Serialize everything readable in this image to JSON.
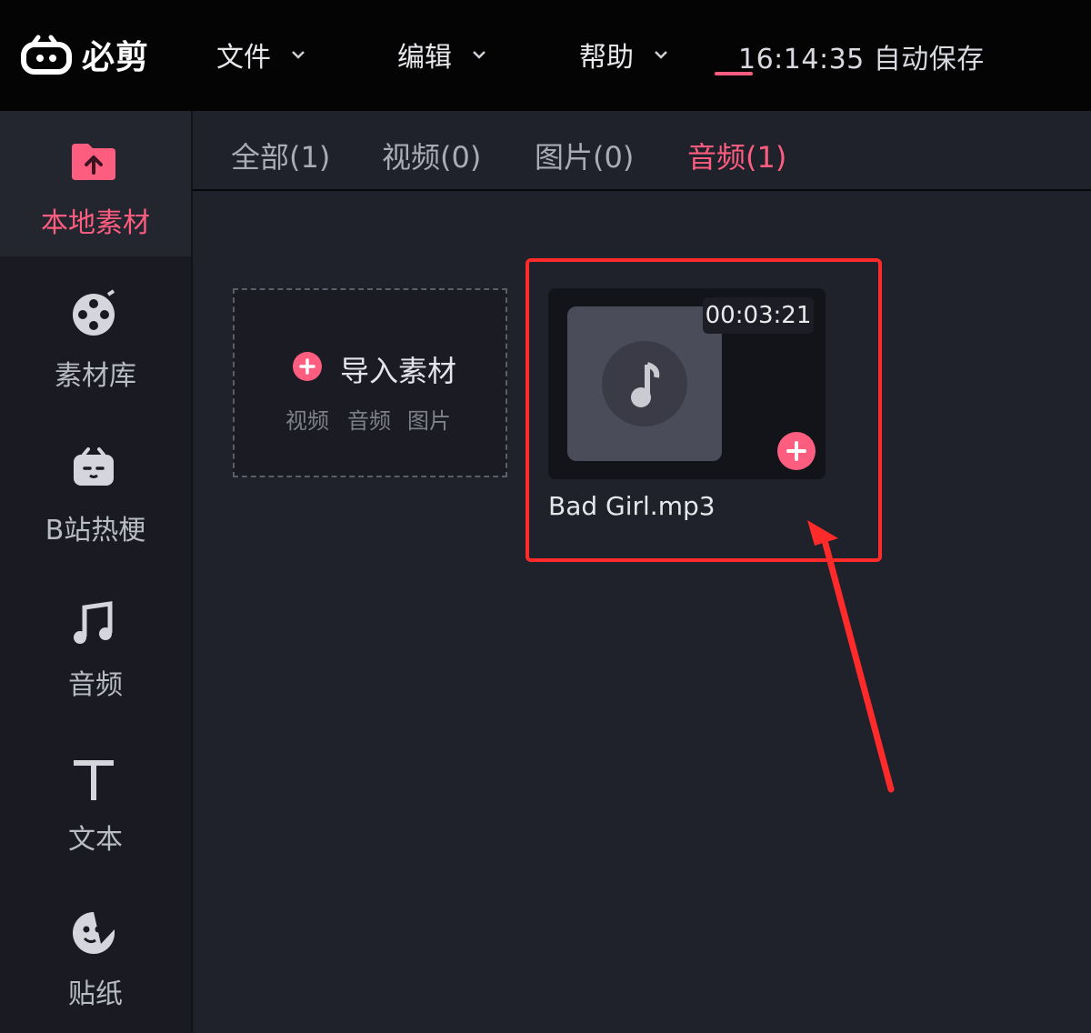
{
  "app": {
    "name": "必剪"
  },
  "menu": {
    "file": "文件",
    "edit": "编辑",
    "help": "帮助"
  },
  "autosave": "16:14:35 自动保存",
  "sidebar": {
    "items": [
      {
        "label": "本地素材",
        "icon": "folder-upload-icon"
      },
      {
        "label": "素材库",
        "icon": "film-reel-icon"
      },
      {
        "label": "B站热梗",
        "icon": "bilibili-tv-icon"
      },
      {
        "label": "音频",
        "icon": "music-note-icon"
      },
      {
        "label": "文本",
        "icon": "text-t-icon"
      },
      {
        "label": "贴纸",
        "icon": "sticker-face-icon"
      }
    ]
  },
  "tabs": [
    {
      "label": "全部(1)"
    },
    {
      "label": "视频(0)"
    },
    {
      "label": "图片(0)"
    },
    {
      "label": "音频(1)"
    }
  ],
  "import": {
    "title": "导入素材",
    "types": [
      "视频",
      "音频",
      "图片"
    ]
  },
  "media": {
    "duration": "00:03:21",
    "filename": "Bad Girl.mp3"
  },
  "colors": {
    "accent": "#fd5d7e",
    "highlight": "#ff2a2a",
    "topbar": "#040405",
    "panel": "#1f212b",
    "sidebar": "#191a22"
  }
}
